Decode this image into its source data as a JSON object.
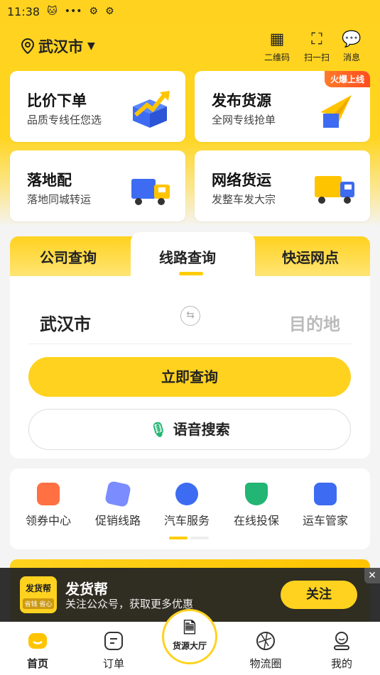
{
  "status": {
    "time": "11:38",
    "icons": [
      "cat-icon",
      "more-icon",
      "gear-icon",
      "gear-icon"
    ]
  },
  "header": {
    "city": "武汉市",
    "actions": [
      {
        "label": "二维码",
        "icon": "qrcode-icon"
      },
      {
        "label": "扫一扫",
        "icon": "scan-icon"
      },
      {
        "label": "消息",
        "icon": "message-icon"
      }
    ]
  },
  "cards": [
    {
      "title": "比价下单",
      "subtitle": "品质专线任您选",
      "icon": "box-arrow-icon"
    },
    {
      "title": "发布货源",
      "subtitle": "全网专线抢单",
      "icon": "paper-plane-icon",
      "badge": "火爆上线"
    },
    {
      "title": "落地配",
      "subtitle": "落地同城转运",
      "icon": "van-icon"
    },
    {
      "title": "网络货运",
      "subtitle": "发整车发大宗",
      "icon": "truck-icon"
    }
  ],
  "query": {
    "tabs": [
      "公司查询",
      "线路查询",
      "快运网点"
    ],
    "from": "武汉市",
    "to": "目的地",
    "search_button": "立即查询",
    "voice_button": "语音搜索"
  },
  "services": [
    {
      "label": "领券中心",
      "color": "#ff7043"
    },
    {
      "label": "促销线路",
      "color": "#7b8cff"
    },
    {
      "label": "汽车服务",
      "color": "#3d6cf2"
    },
    {
      "label": "在线投保",
      "color": "#22b573"
    },
    {
      "label": "运车管家",
      "color": "#3d6cf2"
    }
  ],
  "follow_bar": {
    "logo_text": "发货帮",
    "logo_sub": "省钱 省心",
    "name": "发货帮",
    "desc": "关注公众号，获取更多优惠",
    "button": "关注",
    "close": "✕"
  },
  "nav": {
    "items": [
      "首页",
      "订单",
      "物流圈",
      "我的"
    ],
    "center": "货源大厅"
  },
  "colors": {
    "brand": "#ffd21f"
  }
}
